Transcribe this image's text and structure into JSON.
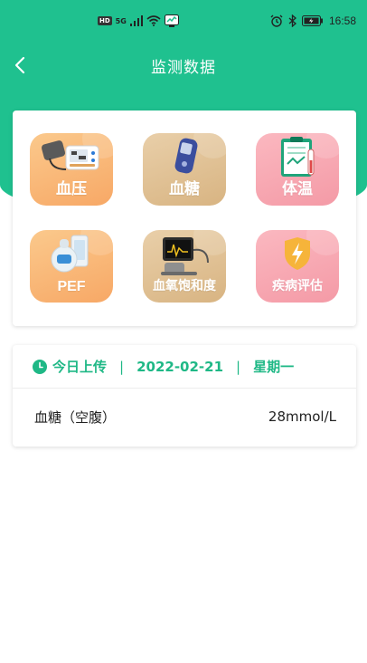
{
  "status_bar": {
    "hd": "HD",
    "network": "5G",
    "time": "16:58"
  },
  "nav": {
    "title": "监测数据",
    "back_icon": "chevron-left-icon"
  },
  "devices": [
    {
      "label": "血压",
      "icon": "blood-pressure-monitor-icon",
      "color": "#f7a866"
    },
    {
      "label": "血糖",
      "icon": "glucose-meter-icon",
      "color": "#d8b482"
    },
    {
      "label": "体温",
      "icon": "temperature-record-icon",
      "color": "#f49aa6"
    },
    {
      "label": "PEF",
      "icon": "peak-flow-meter-icon",
      "color": "#f7a866"
    },
    {
      "label": "血氧饱和度",
      "icon": "pulse-oximeter-icon",
      "color": "#d8b482"
    },
    {
      "label": "疾病评估",
      "icon": "shield-lightning-icon",
      "color": "#f49aa6"
    }
  ],
  "upload": {
    "title": "今日上传",
    "date": "2022-02-21",
    "weekday": "星期一",
    "separator": "|",
    "accent": "#1fb886",
    "records": [
      {
        "name": "血糖（空腹）",
        "value": "28mmol/L"
      }
    ]
  },
  "theme": {
    "primary": "#1fc18f"
  }
}
